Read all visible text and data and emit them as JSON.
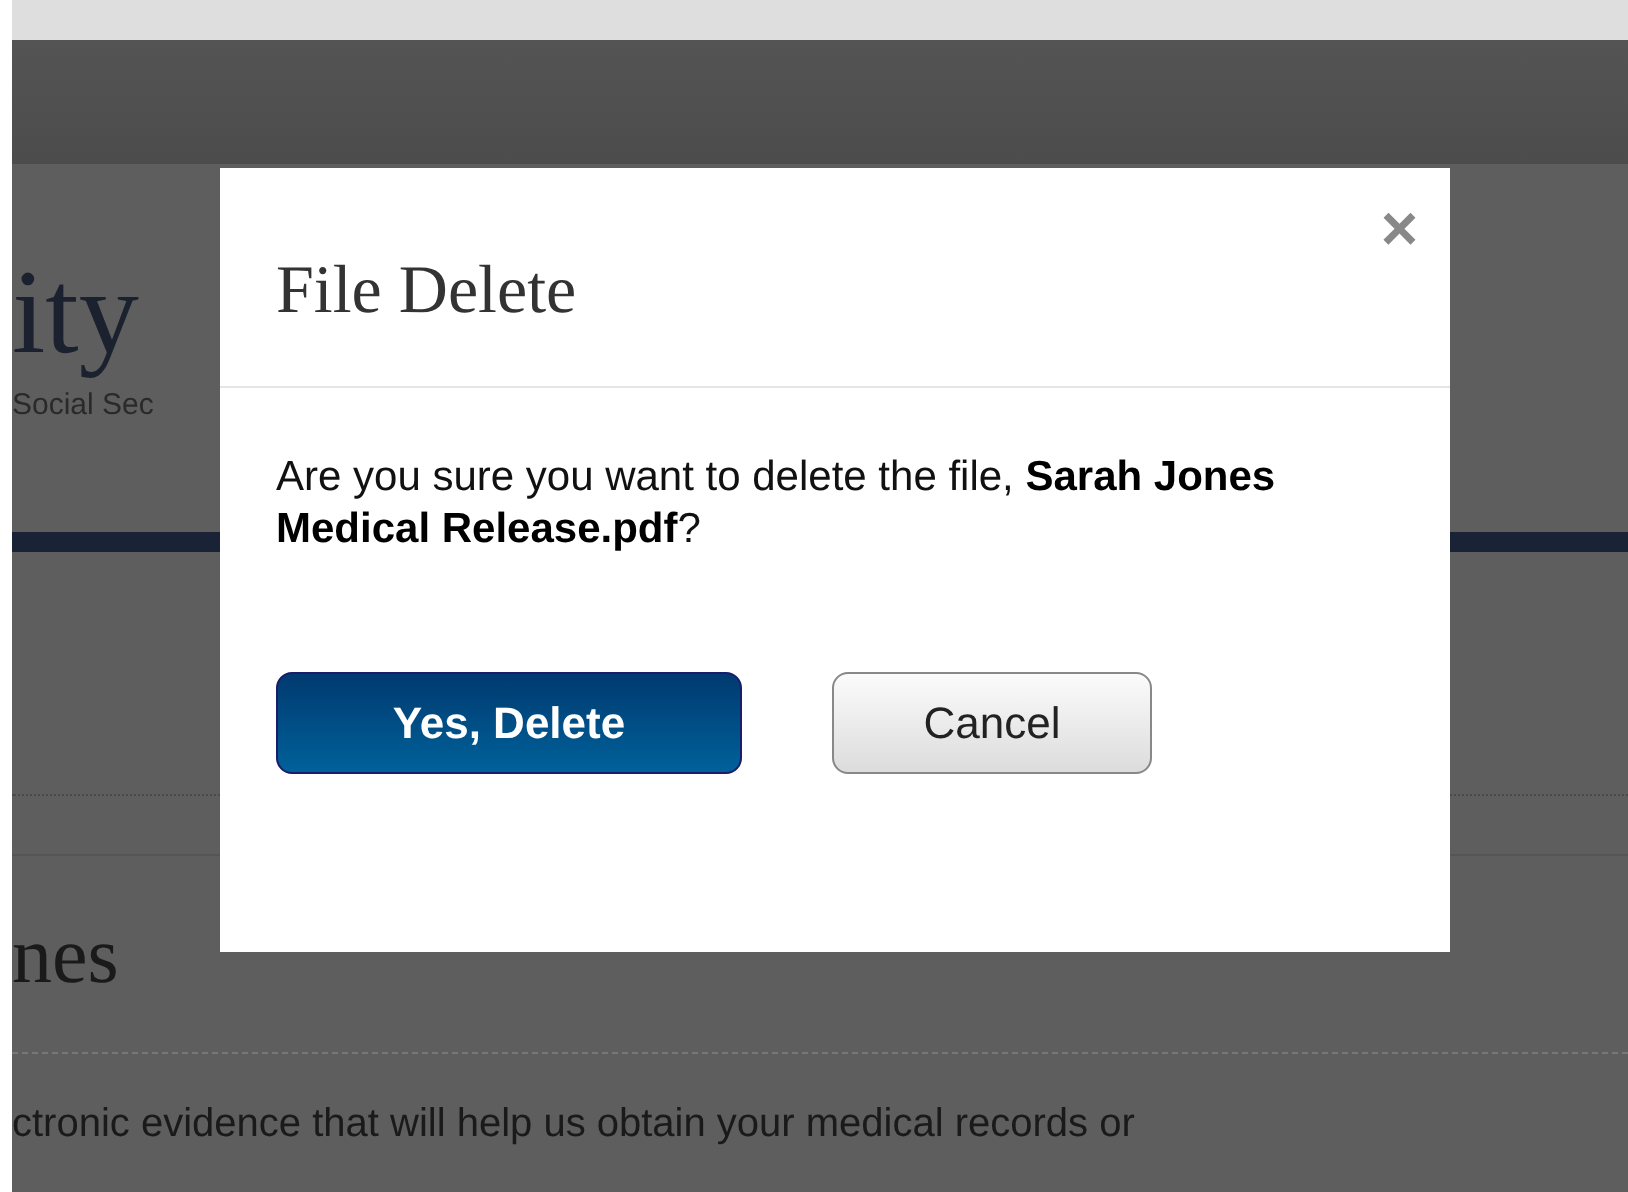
{
  "page": {
    "logo_fragment": "ity",
    "tagline_fragment": "Social Sec",
    "section_heading_fragment": "nes",
    "paragraph_fragment": "ctronic evidence that will help us obtain your medical records or"
  },
  "dialog": {
    "title": "File Delete",
    "close": "×",
    "message": "Are you sure you want to delete the file, **Sarah Jones Medical Release.pdf**?",
    "buttons": [
      {
        "label": "Yes, Delete",
        "kind": "primary"
      },
      {
        "label": "Cancel",
        "kind": "secondary"
      }
    ]
  }
}
